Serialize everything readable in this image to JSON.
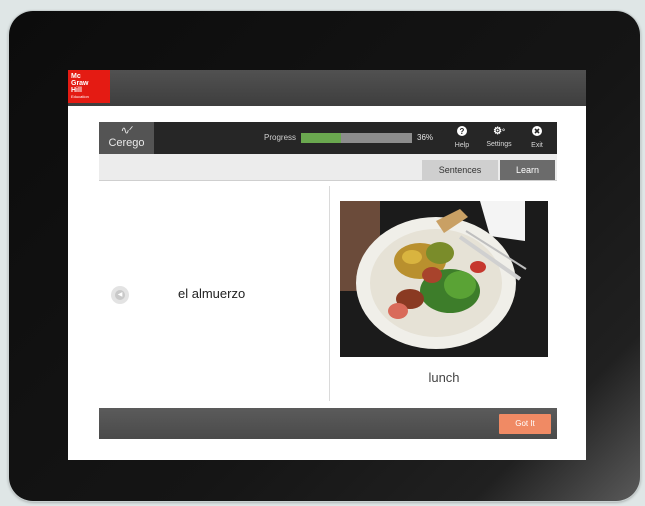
{
  "brand": {
    "logo_lines": [
      "Mc",
      "Graw",
      "Hill"
    ],
    "logo_sub": "Education"
  },
  "toolbar": {
    "cerego_wave": "∿ᐟ",
    "cerego_name": "Cerego",
    "progress_label": "Progress",
    "progress_fraction": 0.36,
    "progress_text": "36%",
    "help_label": "Help",
    "settings_label": "Settings",
    "exit_label": "Exit"
  },
  "tabs": [
    {
      "label": "Sentences",
      "active": false
    },
    {
      "label": "Learn",
      "active": true
    }
  ],
  "card": {
    "term": "el almuerzo",
    "translation": "lunch"
  },
  "actions": {
    "got_it_label": "Got It"
  },
  "colors": {
    "accent_red": "#e41b13",
    "progress_green": "#6aa84f",
    "button_orange": "#f08a64"
  },
  "icons": {
    "help": "help-icon",
    "settings": "settings-icon",
    "exit": "exit-icon",
    "audio": "audio-icon"
  }
}
